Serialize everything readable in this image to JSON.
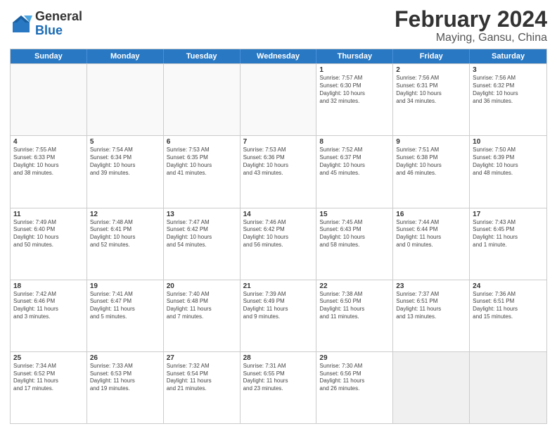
{
  "header": {
    "logo_general": "General",
    "logo_blue": "Blue",
    "title": "February 2024",
    "subtitle": "Maying, Gansu, China"
  },
  "days": [
    "Sunday",
    "Monday",
    "Tuesday",
    "Wednesday",
    "Thursday",
    "Friday",
    "Saturday"
  ],
  "rows": [
    [
      {
        "num": "",
        "lines": [],
        "empty": true
      },
      {
        "num": "",
        "lines": [],
        "empty": true
      },
      {
        "num": "",
        "lines": [],
        "empty": true
      },
      {
        "num": "",
        "lines": [],
        "empty": true
      },
      {
        "num": "1",
        "lines": [
          "Sunrise: 7:57 AM",
          "Sunset: 6:30 PM",
          "Daylight: 10 hours",
          "and 32 minutes."
        ]
      },
      {
        "num": "2",
        "lines": [
          "Sunrise: 7:56 AM",
          "Sunset: 6:31 PM",
          "Daylight: 10 hours",
          "and 34 minutes."
        ]
      },
      {
        "num": "3",
        "lines": [
          "Sunrise: 7:56 AM",
          "Sunset: 6:32 PM",
          "Daylight: 10 hours",
          "and 36 minutes."
        ]
      }
    ],
    [
      {
        "num": "4",
        "lines": [
          "Sunrise: 7:55 AM",
          "Sunset: 6:33 PM",
          "Daylight: 10 hours",
          "and 38 minutes."
        ]
      },
      {
        "num": "5",
        "lines": [
          "Sunrise: 7:54 AM",
          "Sunset: 6:34 PM",
          "Daylight: 10 hours",
          "and 39 minutes."
        ]
      },
      {
        "num": "6",
        "lines": [
          "Sunrise: 7:53 AM",
          "Sunset: 6:35 PM",
          "Daylight: 10 hours",
          "and 41 minutes."
        ]
      },
      {
        "num": "7",
        "lines": [
          "Sunrise: 7:53 AM",
          "Sunset: 6:36 PM",
          "Daylight: 10 hours",
          "and 43 minutes."
        ]
      },
      {
        "num": "8",
        "lines": [
          "Sunrise: 7:52 AM",
          "Sunset: 6:37 PM",
          "Daylight: 10 hours",
          "and 45 minutes."
        ]
      },
      {
        "num": "9",
        "lines": [
          "Sunrise: 7:51 AM",
          "Sunset: 6:38 PM",
          "Daylight: 10 hours",
          "and 46 minutes."
        ]
      },
      {
        "num": "10",
        "lines": [
          "Sunrise: 7:50 AM",
          "Sunset: 6:39 PM",
          "Daylight: 10 hours",
          "and 48 minutes."
        ]
      }
    ],
    [
      {
        "num": "11",
        "lines": [
          "Sunrise: 7:49 AM",
          "Sunset: 6:40 PM",
          "Daylight: 10 hours",
          "and 50 minutes."
        ]
      },
      {
        "num": "12",
        "lines": [
          "Sunrise: 7:48 AM",
          "Sunset: 6:41 PM",
          "Daylight: 10 hours",
          "and 52 minutes."
        ]
      },
      {
        "num": "13",
        "lines": [
          "Sunrise: 7:47 AM",
          "Sunset: 6:42 PM",
          "Daylight: 10 hours",
          "and 54 minutes."
        ]
      },
      {
        "num": "14",
        "lines": [
          "Sunrise: 7:46 AM",
          "Sunset: 6:42 PM",
          "Daylight: 10 hours",
          "and 56 minutes."
        ]
      },
      {
        "num": "15",
        "lines": [
          "Sunrise: 7:45 AM",
          "Sunset: 6:43 PM",
          "Daylight: 10 hours",
          "and 58 minutes."
        ]
      },
      {
        "num": "16",
        "lines": [
          "Sunrise: 7:44 AM",
          "Sunset: 6:44 PM",
          "Daylight: 11 hours",
          "and 0 minutes."
        ]
      },
      {
        "num": "17",
        "lines": [
          "Sunrise: 7:43 AM",
          "Sunset: 6:45 PM",
          "Daylight: 11 hours",
          "and 1 minute."
        ]
      }
    ],
    [
      {
        "num": "18",
        "lines": [
          "Sunrise: 7:42 AM",
          "Sunset: 6:46 PM",
          "Daylight: 11 hours",
          "and 3 minutes."
        ]
      },
      {
        "num": "19",
        "lines": [
          "Sunrise: 7:41 AM",
          "Sunset: 6:47 PM",
          "Daylight: 11 hours",
          "and 5 minutes."
        ]
      },
      {
        "num": "20",
        "lines": [
          "Sunrise: 7:40 AM",
          "Sunset: 6:48 PM",
          "Daylight: 11 hours",
          "and 7 minutes."
        ]
      },
      {
        "num": "21",
        "lines": [
          "Sunrise: 7:39 AM",
          "Sunset: 6:49 PM",
          "Daylight: 11 hours",
          "and 9 minutes."
        ]
      },
      {
        "num": "22",
        "lines": [
          "Sunrise: 7:38 AM",
          "Sunset: 6:50 PM",
          "Daylight: 11 hours",
          "and 11 minutes."
        ]
      },
      {
        "num": "23",
        "lines": [
          "Sunrise: 7:37 AM",
          "Sunset: 6:51 PM",
          "Daylight: 11 hours",
          "and 13 minutes."
        ]
      },
      {
        "num": "24",
        "lines": [
          "Sunrise: 7:36 AM",
          "Sunset: 6:51 PM",
          "Daylight: 11 hours",
          "and 15 minutes."
        ]
      }
    ],
    [
      {
        "num": "25",
        "lines": [
          "Sunrise: 7:34 AM",
          "Sunset: 6:52 PM",
          "Daylight: 11 hours",
          "and 17 minutes."
        ]
      },
      {
        "num": "26",
        "lines": [
          "Sunrise: 7:33 AM",
          "Sunset: 6:53 PM",
          "Daylight: 11 hours",
          "and 19 minutes."
        ]
      },
      {
        "num": "27",
        "lines": [
          "Sunrise: 7:32 AM",
          "Sunset: 6:54 PM",
          "Daylight: 11 hours",
          "and 21 minutes."
        ]
      },
      {
        "num": "28",
        "lines": [
          "Sunrise: 7:31 AM",
          "Sunset: 6:55 PM",
          "Daylight: 11 hours",
          "and 23 minutes."
        ]
      },
      {
        "num": "29",
        "lines": [
          "Sunrise: 7:30 AM",
          "Sunset: 6:56 PM",
          "Daylight: 11 hours",
          "and 26 minutes."
        ]
      },
      {
        "num": "",
        "lines": [],
        "empty": true,
        "shaded": true
      },
      {
        "num": "",
        "lines": [],
        "empty": true,
        "shaded": true
      }
    ]
  ]
}
